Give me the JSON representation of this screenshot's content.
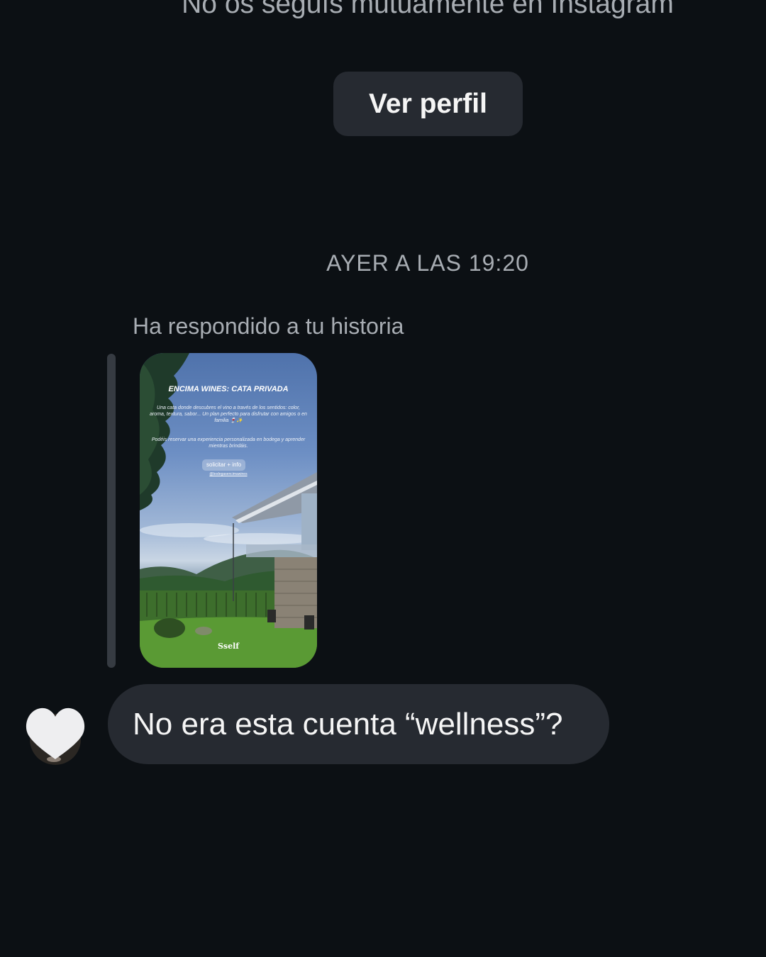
{
  "thread": {
    "mutual_note": "No os seguís mutuamente en Instagram",
    "view_profile_label": "Ver perfil",
    "timestamp": "AYER A LAS 19:20",
    "reply_label": "Ha respondido a tu historia"
  },
  "story": {
    "title": "ENCIMA WINES: CATA PRIVADA",
    "body_1": "Una cata donde descubres el vino a través de los sentidos: color, aroma, textura, sabor... Un plan perfecto para disfrutar con amigos o en familia 🍷✨",
    "body_2": "Podéis reservar una experiencia personalizada en bodega y aprender mientras brindáis.",
    "link_button": "solicitar + info",
    "handle": "@bodegasencimawines",
    "logo": "Sself"
  },
  "message": {
    "text": "No era esta cuenta “wellness”?"
  },
  "avatar": {
    "icon": "heart-icon"
  },
  "colors": {
    "background": "#0c1014",
    "bubble": "#262a31",
    "secondary_text": "#a8adb3",
    "primary_text": "#f5f5f5"
  }
}
